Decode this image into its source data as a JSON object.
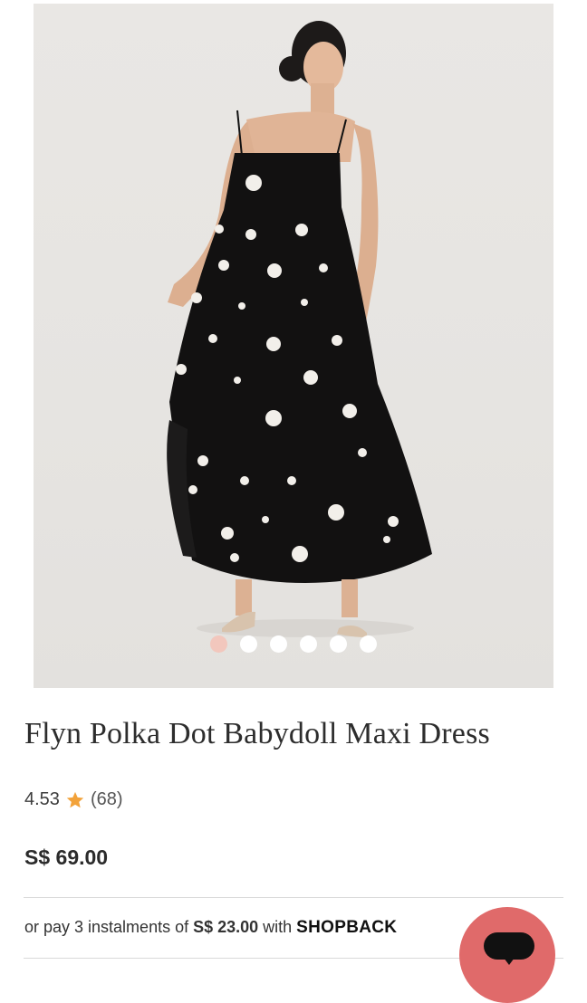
{
  "product": {
    "title": "Flyn Polka Dot Babydoll Maxi Dress",
    "rating": "4.53",
    "review_count": "(68)",
    "price": "S$ 69.00"
  },
  "gallery": {
    "image_icon": "product-photo",
    "dot_count": 6,
    "active_index": 0
  },
  "installment": {
    "prefix": "or pay 3 instalments of ",
    "amount": "S$ 23.00",
    "middle": " with ",
    "brand": "SHOPBACK"
  },
  "chat": {
    "icon": "chat-bubble-icon"
  },
  "colors": {
    "accent_dot": "#f2c7bd",
    "star": "#f2a23a",
    "chat_button": "#e06a6a",
    "background_photo": "#e7e5e2"
  }
}
